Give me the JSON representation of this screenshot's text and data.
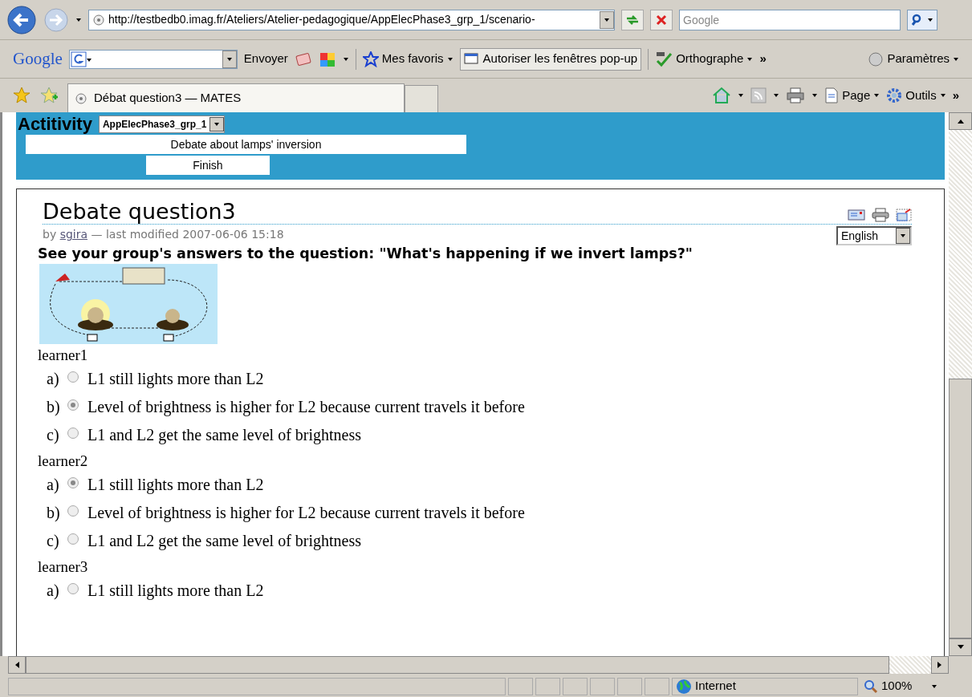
{
  "browser": {
    "address": "http://testbedb0.imag.fr/Ateliers/Atelier-pedagogique/AppElecPhase3_grp_1/scenario-",
    "search_placeholder": "Google",
    "google_bar": {
      "logo": "Google",
      "send": "Envoyer",
      "favorites": "Mes favoris",
      "popups": "Autoriser les fenêtres pop-up",
      "spelling": "Orthographe",
      "more": "»",
      "settings": "Paramètres"
    },
    "tab": {
      "title": "Débat question3 — MATES"
    },
    "commands": {
      "page": "Page",
      "tools": "Outils",
      "more": "»"
    }
  },
  "activity": {
    "label": "Actitivity",
    "select": "AppElecPhase3_grp_1",
    "links": [
      {
        "label": "Debate about lamps' inversion"
      },
      {
        "label": "Finish"
      }
    ]
  },
  "document": {
    "title": "Debate question3",
    "byline_prefix": "by",
    "author": "sgira",
    "byline_suffix": "— last modified 2007-06-06 15:18",
    "language": "English",
    "question": "See your group's answers to the question: \"What's happening if we invert lamps?\"",
    "learners": [
      {
        "name": "learner1",
        "options": [
          {
            "letter": "a)",
            "text": "L1 still lights more than L2",
            "selected": false
          },
          {
            "letter": "b)",
            "text": "Level of brightness is higher for L2 because current travels it before",
            "selected": true
          },
          {
            "letter": "c)",
            "text": "L1 and L2 get the same level of brightness",
            "selected": false
          }
        ]
      },
      {
        "name": "learner2",
        "options": [
          {
            "letter": "a)",
            "text": "L1 still lights more than L2",
            "selected": true
          },
          {
            "letter": "b)",
            "text": "Level of brightness is higher for L2 because current travels it before",
            "selected": false
          },
          {
            "letter": "c)",
            "text": "L1 and L2 get the same level of brightness",
            "selected": false
          }
        ]
      },
      {
        "name": "learner3",
        "options": [
          {
            "letter": "a)",
            "text": "L1 still lights more than L2",
            "selected": false
          }
        ]
      }
    ]
  },
  "status_bar": {
    "zone": "Internet",
    "zoom": "100%"
  }
}
